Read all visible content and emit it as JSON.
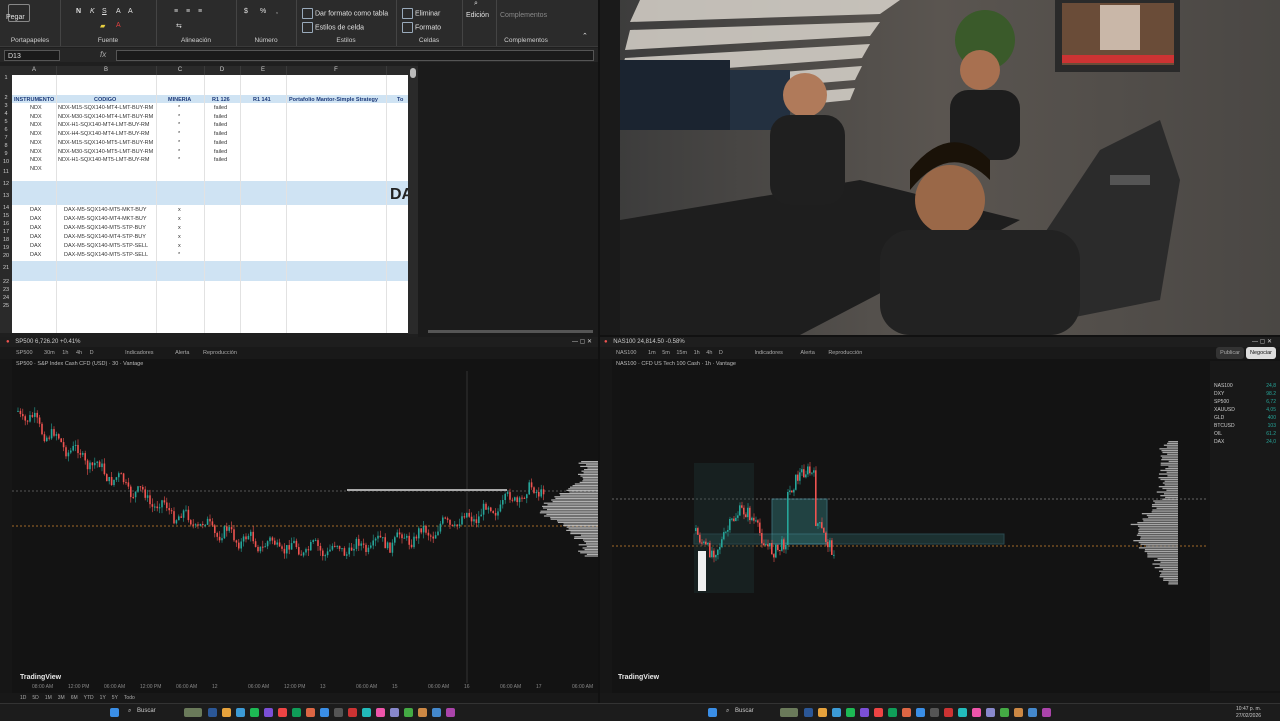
{
  "excel": {
    "ribbon": {
      "paste": "Pegar",
      "groups": [
        "Portapapeles",
        "Fuente",
        "Alineación",
        "Número",
        "Estilos",
        "Celdas",
        "Complementos"
      ],
      "format_as_table": "Dar formato como tabla",
      "cell_styles": "Estilos de celda",
      "delete": "Eliminar",
      "format": "Formato",
      "editing": "Edición",
      "addins": "Complementos"
    },
    "namebox": "D13",
    "fx": "fx",
    "columns": [
      "A",
      "B",
      "C",
      "D",
      "E",
      "F"
    ],
    "headers": {
      "instrumento": "INSTRUMENTO",
      "codigo": "CODIGO",
      "mineria": "MINERIA",
      "r126": "R1 126",
      "r141": "R1 141",
      "portfolio": "Portafolio Mantor-Simple Strategy",
      "extra": "To"
    },
    "rows_nq": [
      {
        "inst": "NDX",
        "code": "NDX-M15-SQX140-MT4-LMT-BUY-RM",
        "min": "*",
        "status": "failed"
      },
      {
        "inst": "NDX",
        "code": "NDX-M30-SQX140-MT4-LMT-BUY-RM",
        "min": "*",
        "status": "failed"
      },
      {
        "inst": "NDX",
        "code": "NDX-H1-SQX140-MT4-LMT-BUY-RM",
        "min": "*",
        "status": "failed"
      },
      {
        "inst": "NDX",
        "code": "NDX-H4-SQX140-MT4-LMT-BUY-RM",
        "min": "*",
        "status": "failed"
      },
      {
        "inst": "NDX",
        "code": "NDX-M15-SQX140-MT5-LMT-BUY-RM",
        "min": "*",
        "status": "failed"
      },
      {
        "inst": "NDX",
        "code": "NDX-M30-SQX140-MT5-LMT-BUY-RM",
        "min": "*",
        "status": "failed"
      },
      {
        "inst": "NDX",
        "code": "NDX-H1-SQX140-MT5-LMT-BUY-RM",
        "min": "*",
        "status": "failed"
      },
      {
        "inst": "NDX",
        "code": "",
        "min": "",
        "status": ""
      }
    ],
    "section_title": "DA",
    "rows_dax": [
      {
        "inst": "DAX",
        "code": "DAX-M5-SQX140-MT5-MKT-BUY",
        "min": "x"
      },
      {
        "inst": "DAX",
        "code": "DAX-M5-SQX140-MT4-MKT-BUY",
        "min": "x"
      },
      {
        "inst": "DAX",
        "code": "DAX-M5-SQX140-MT5-STP-BUY",
        "min": "x"
      },
      {
        "inst": "DAX",
        "code": "DAX-M5-SQX140-MT4-STP-BUY",
        "min": "x"
      },
      {
        "inst": "DAX",
        "code": "DAX-M5-SQX140-MT5-STP-SELL",
        "min": "x"
      },
      {
        "inst": "DAX",
        "code": "DAX-M5-SQX140-MT5-STP-SELL",
        "min": "*"
      }
    ],
    "row_numbers": [
      "1",
      "2",
      "3",
      "4",
      "5",
      "6",
      "7",
      "8",
      "9",
      "10",
      "11",
      "12",
      "13",
      "14",
      "15",
      "16",
      "17",
      "18",
      "19",
      "20",
      "21",
      "22",
      "23",
      "24",
      "25"
    ]
  },
  "tv_left": {
    "tab": "SP500 6,726.20 +0.41%",
    "symbol": "SP500 · S&P Index Cash CFD (USD) · 30 · Vantage",
    "toolbar": [
      "SP500",
      "30m",
      "1h",
      "4h",
      "D",
      "Indicadores",
      "Alerta",
      "Reproducción"
    ],
    "logo": "TradingView",
    "time_axis": [
      "08:00 AM",
      "12:00 PM",
      "06:00 AM",
      "12:00 PM",
      "06:00 AM",
      "12",
      "06:00 AM",
      "12:00 PM",
      "13",
      "06:00 AM",
      "15",
      "06:00 AM",
      "16",
      "06:00 AM",
      "17",
      "06:00 AM"
    ],
    "bottom_tabs": [
      "1D",
      "5D",
      "1M",
      "3M",
      "6M",
      "YTD",
      "1Y",
      "5Y",
      "Todo"
    ]
  },
  "tv_right": {
    "tab": "NAS100 24,814.50 -0.58%",
    "symbol": "NAS100 · CFD US Tech 100 Cash · 1h · Vantage",
    "toolbar": [
      "NAS100",
      "1m",
      "5m",
      "15m",
      "1h",
      "4h",
      "D",
      "Indicadores",
      "Alerta",
      "Reproducción"
    ],
    "logo": "TradingView",
    "watchlist": [
      {
        "sym": "NAS100",
        "val": "24,8"
      },
      {
        "sym": "DXY",
        "val": "98.2"
      },
      {
        "sym": "SP500",
        "val": "6,72"
      },
      {
        "sym": "XAUUSD",
        "val": "4,05"
      },
      {
        "sym": "GLD",
        "val": "400"
      },
      {
        "sym": "BTCUSD",
        "val": "103"
      },
      {
        "sym": "OIL",
        "val": "61.2"
      },
      {
        "sym": "DAX",
        "val": "24,0"
      }
    ],
    "buttons": [
      "Publicar",
      "Negociar"
    ]
  },
  "taskbar": {
    "search": "Buscar",
    "search2": "Buscar",
    "time": "10:47 p. m.",
    "date": "27/02/2026"
  },
  "colors": {
    "bull": "#26a69a",
    "bear": "#ef5350",
    "excel_band": "#cfe3f3",
    "header_text": "#1c3a7a"
  }
}
